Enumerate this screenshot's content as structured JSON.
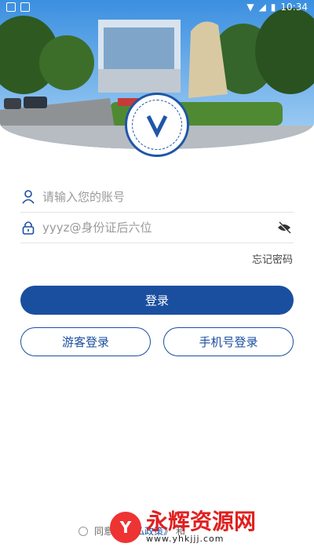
{
  "status_bar": {
    "time": "10:34"
  },
  "login": {
    "account_placeholder": "请输入您的账号",
    "password_placeholder": "yyyz@身份证后六位",
    "forgot_password": "忘记密码",
    "login_button": "登录",
    "guest_login": "游客登录",
    "phone_login": "手机号登录"
  },
  "agreement": {
    "prefix": "同意",
    "link1": "《隐私政策》",
    "mid": "和"
  },
  "watermark": {
    "brand": "永辉资源网",
    "url": "www.yhkjjj.com"
  },
  "colors": {
    "primary": "#1a4fa0",
    "emblem": "#1f56a8"
  }
}
